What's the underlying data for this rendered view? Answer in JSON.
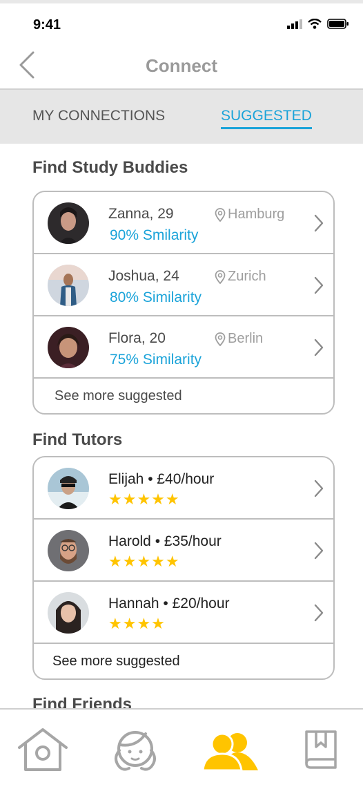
{
  "status": {
    "time": "9:41"
  },
  "nav": {
    "title": "Connect"
  },
  "tabs": {
    "my_connections": "MY CONNECTIONS",
    "suggested": "SUGGESTED"
  },
  "study": {
    "title": "Find Study Buddies",
    "items": [
      {
        "name": "Zanna, 29",
        "location": "Hamburg",
        "similarity": "90% Smilarity"
      },
      {
        "name": "Joshua, 24",
        "location": "Zurich",
        "similarity": "80% Similarity"
      },
      {
        "name": "Flora, 20",
        "location": "Berlin",
        "similarity": "75% Similarity"
      }
    ],
    "more": "See more suggested"
  },
  "tutors": {
    "title": "Find Tutors",
    "items": [
      {
        "name": "Elijah • £40/hour",
        "stars": "★★★★★"
      },
      {
        "name": "Harold • £35/hour",
        "stars": "★★★★★"
      },
      {
        "name": "Hannah • £20/hour",
        "stars": "★★★★"
      }
    ],
    "more": "See more suggested"
  },
  "friends": {
    "title": "Find Friends"
  },
  "colors": {
    "accent": "#1aa3d9",
    "star": "#ffc400",
    "active_tab": "#ffc400"
  },
  "tabbar": {
    "icons": [
      "home-icon",
      "profile-icon",
      "connections-icon",
      "book-icon"
    ]
  }
}
